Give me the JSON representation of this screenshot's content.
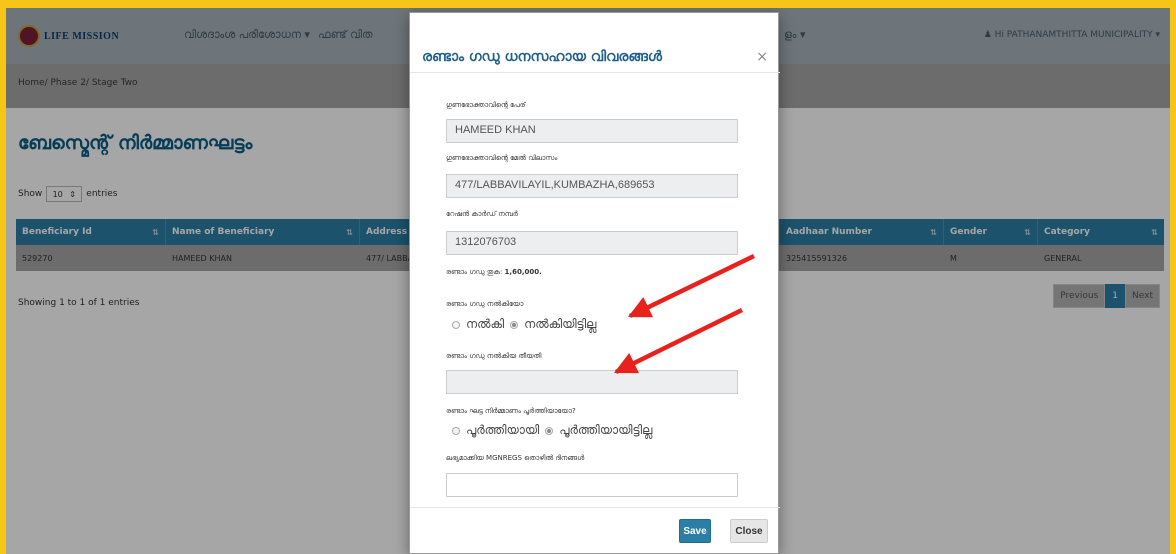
{
  "navbar": {
    "logo_text": "LIFE MISSION",
    "menu_items": [
      "വിശദാംശ പരിശോധന ▾",
      "ഫണ്ട് വിത",
      "ളം ▾"
    ],
    "user_label": "Hi PATHANAMTHITTA MUNICIPALITY ▾"
  },
  "breadcrumb": "Home/ Phase 2/ Stage Two",
  "page_title": "ബേസ്മെന്റ് നിർമ്മാണഘട്ടം",
  "table_controls": {
    "show_label": "Show",
    "entries_value": "10",
    "entries_label": "entries",
    "showing_text": "Showing 1 to 1 of 1 entries"
  },
  "table": {
    "columns": [
      "Beneficiary Id",
      "Name of Beneficiary",
      "Address",
      "Aadhaar Number",
      "Gender",
      "Category"
    ],
    "rows": [
      [
        "529270",
        "HAMEED KHAN",
        "477/ LABBAVI",
        "325415591326",
        "M",
        "GENERAL"
      ]
    ]
  },
  "pagination": {
    "previous": "Previous",
    "current": "1",
    "next": "Next"
  },
  "modal": {
    "title": "രണ്ടാം ഗഡു ധനസഹായ വിവരങ്ങൾ",
    "close_symbol": "×",
    "fields": {
      "beneficiary_name_label": "ഗുണഭോക്താവിന്റെ പേര്",
      "beneficiary_name_value": "HAMEED KHAN",
      "address_label": "ഗുണഭോക്താവിന്റെ മേൽ വിലാസം",
      "address_value": "477/LABBAVILAYIL,KUMBAZHA,689653",
      "ration_card_label": "റേഷൻ കാർഡ് നമ്പർ",
      "ration_card_value": "1312076703",
      "amount_label": "രണ്ടാം ഗഡു തുക:",
      "amount_value": "1,60,000.",
      "given_label": "രണ്ടാം ഗഡു നൽകിയോ",
      "given_option_yes": "നൽകി",
      "given_option_no": "നൽകിയിട്ടില്ല",
      "given_date_label": "രണ്ടാം ഗഡു നൽകിയ തീയതി",
      "given_date_value": "",
      "completed_label": "രണ്ടാം ഘട്ട നിർമ്മാണം പൂർത്തിയായോ?",
      "completed_option_yes": "പൂർത്തിയായി",
      "completed_option_no": "പൂർത്തിയായിട്ടില്ല",
      "mgnregs_label": "ലഭ്യമാക്കിയ MGNREGS തൊഴിൽ ദിനങ്ങൾ",
      "mgnregs_value": ""
    },
    "save_label": "Save",
    "close_label": "Close"
  },
  "colors": {
    "border": "#f5c518",
    "primary": "#2b7fa6",
    "annotation_arrow": "#e8211d"
  }
}
